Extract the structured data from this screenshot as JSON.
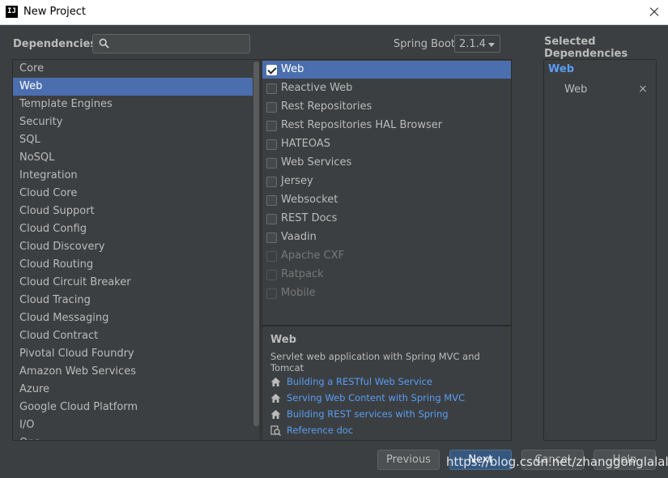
{
  "window": {
    "title": "New Project",
    "app_icon_text": "IJ"
  },
  "header": {
    "dependencies_label": "Dependencies",
    "search_value": "",
    "search_placeholder": "",
    "spring_boot_label": "Spring Boot",
    "spring_boot_version": "2.1.4",
    "selected_header": "Selected Dependencies"
  },
  "categories": [
    "Core",
    "Web",
    "Template Engines",
    "Security",
    "SQL",
    "NoSQL",
    "Integration",
    "Cloud Core",
    "Cloud Support",
    "Cloud Config",
    "Cloud Discovery",
    "Cloud Routing",
    "Cloud Circuit Breaker",
    "Cloud Tracing",
    "Cloud Messaging",
    "Cloud Contract",
    "Pivotal Cloud Foundry",
    "Amazon Web Services",
    "Azure",
    "Google Cloud Platform",
    "I/O",
    "Ops"
  ],
  "selected_category_index": 1,
  "dependencies": [
    {
      "label": "Web",
      "checked": true,
      "disabled": false
    },
    {
      "label": "Reactive Web",
      "checked": false,
      "disabled": false
    },
    {
      "label": "Rest Repositories",
      "checked": false,
      "disabled": false
    },
    {
      "label": "Rest Repositories HAL Browser",
      "checked": false,
      "disabled": false
    },
    {
      "label": "HATEOAS",
      "checked": false,
      "disabled": false
    },
    {
      "label": "Web Services",
      "checked": false,
      "disabled": false
    },
    {
      "label": "Jersey",
      "checked": false,
      "disabled": false
    },
    {
      "label": "Websocket",
      "checked": false,
      "disabled": false
    },
    {
      "label": "REST Docs",
      "checked": false,
      "disabled": false
    },
    {
      "label": "Vaadin",
      "checked": false,
      "disabled": false
    },
    {
      "label": "Apache CXF",
      "checked": false,
      "disabled": true
    },
    {
      "label": "Ratpack",
      "checked": false,
      "disabled": true
    },
    {
      "label": "Mobile",
      "checked": false,
      "disabled": true
    }
  ],
  "description": {
    "title": "Web",
    "text": "Servlet web application with Spring MVC and Tomcat",
    "links": [
      {
        "text": "Building a RESTful Web Service",
        "icon": "home-icon"
      },
      {
        "text": "Serving Web Content with Spring MVC",
        "icon": "home-icon"
      },
      {
        "text": "Building REST services with Spring",
        "icon": "home-icon"
      },
      {
        "text": "Reference doc",
        "icon": "reference-doc-icon"
      }
    ]
  },
  "selected": {
    "group": "Web",
    "items": [
      "Web"
    ]
  },
  "buttons": {
    "previous": "Previous",
    "next": "Next",
    "cancel": "Cancel",
    "help": "Help"
  },
  "watermark": "https://blog.csdn.net/zhanggonglalala",
  "colors": {
    "selection": "#4b6eaf",
    "link": "#589df6",
    "background": "#3c3f41"
  }
}
